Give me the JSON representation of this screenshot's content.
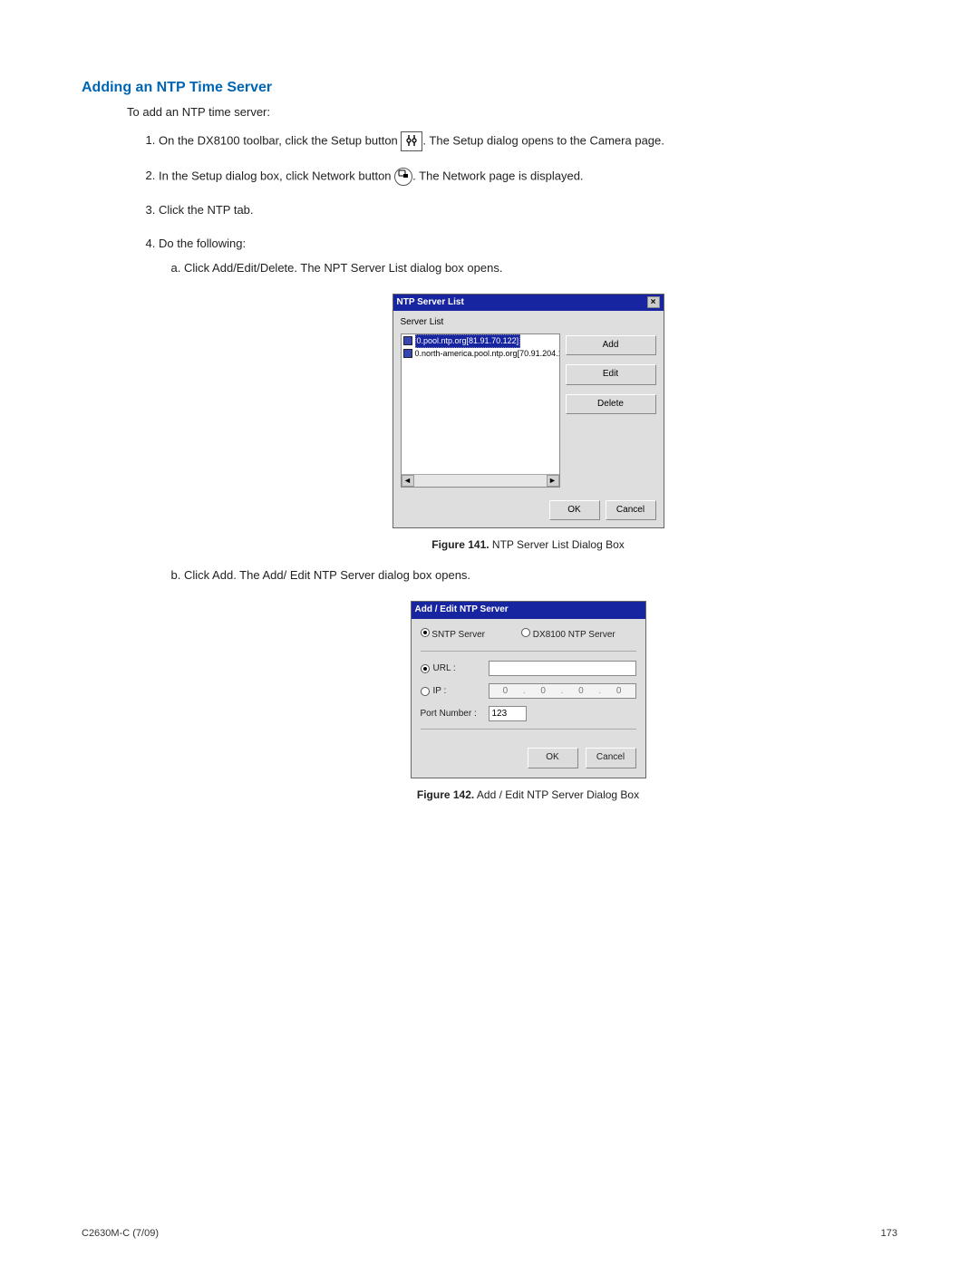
{
  "heading": "Adding an NTP Time Server",
  "intro": "To add an NTP time server:",
  "steps": {
    "s1a": "On the DX8100 toolbar, click the Setup button",
    "s1b": ". The Setup dialog opens to the Camera page.",
    "s2a": "In the Setup dialog box, click Network button",
    "s2b": ". The Network page is displayed.",
    "s3": "Click the NTP tab.",
    "s4": "Do the following:",
    "s4a": "Click Add/Edit/Delete. The NPT Server List dialog box opens.",
    "s4b": "Click Add. The Add/ Edit NTP Server dialog box opens."
  },
  "fig1": {
    "label": "Figure 141.",
    "text": "  NTP Server List Dialog Box"
  },
  "fig2": {
    "label": "Figure 142.",
    "text": "  Add / Edit NTP Server Dialog Box"
  },
  "dlg1": {
    "title": "NTP Server List",
    "label": "Server List",
    "items": {
      "i0": "0.pool.ntp.org[81.91.70.122]",
      "i1": "0.north-america.pool.ntp.org[70.91.204.1"
    },
    "add": "Add",
    "edit": "Edit",
    "del": "Delete",
    "ok": "OK",
    "cancel": "Cancel"
  },
  "dlg2": {
    "title": "Add / Edit NTP Server",
    "sntp": "SNTP Server",
    "dx": "DX8100 NTP Server",
    "url": "URL :",
    "ip": "IP :",
    "port": "Port Number :",
    "portval": "123",
    "ipseg": "0",
    "ok": "OK",
    "cancel": "Cancel"
  },
  "footer": {
    "left": "C2630M-C (7/09)",
    "right": "173"
  }
}
